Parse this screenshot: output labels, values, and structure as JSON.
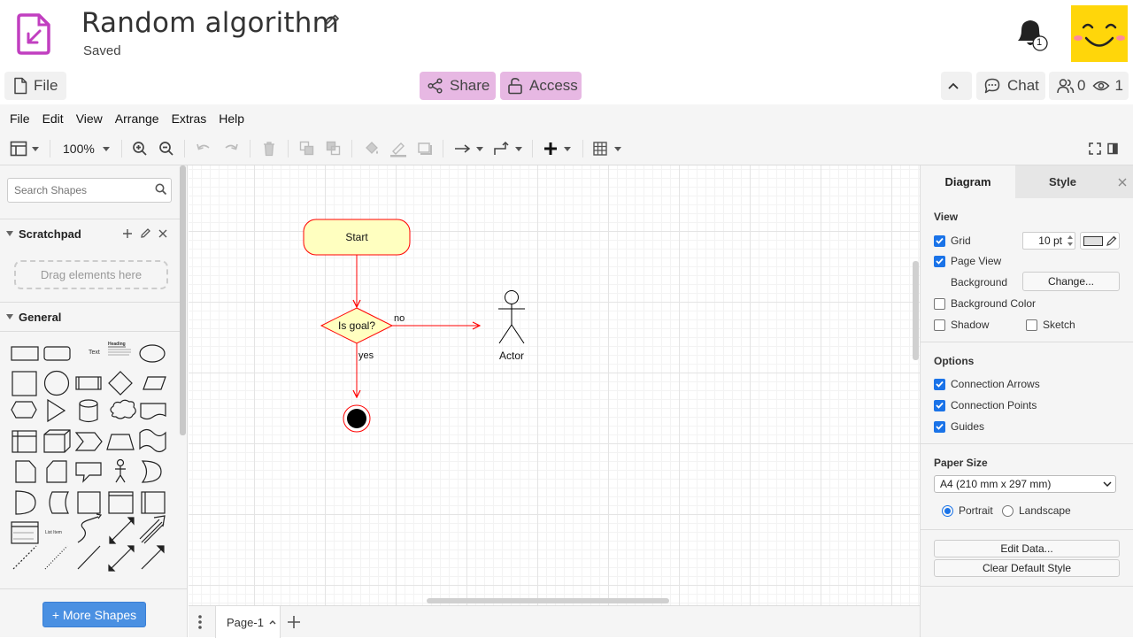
{
  "header": {
    "title": "Random algorithm",
    "status": "Saved",
    "notification_count": "1",
    "file_label": "File",
    "share_label": "Share",
    "access_label": "Access",
    "chat_label": "Chat",
    "users_count": "0",
    "viewers_count": "1"
  },
  "menu": [
    "File",
    "Edit",
    "View",
    "Arrange",
    "Extras",
    "Help"
  ],
  "toolbar": {
    "zoom": "100%"
  },
  "sidebar": {
    "search_placeholder": "Search Shapes",
    "scratchpad_label": "Scratchpad",
    "dropzone_text": "Drag elements here",
    "general_label": "General",
    "shape_text_label": "Text",
    "shape_heading_label": "Heading",
    "shape_list_item_label": "List Item",
    "more_shapes_label": "+ More Shapes"
  },
  "diagram": {
    "start_label": "Start",
    "decision_label": "Is goal?",
    "no_label": "no",
    "yes_label": "yes",
    "actor_label": "Actor",
    "stroke_color": "#ff0000",
    "fill_color": "#ffffc0"
  },
  "pagebar": {
    "page_name": "Page-1"
  },
  "panel": {
    "tab_diagram": "Diagram",
    "tab_style": "Style",
    "view_heading": "View",
    "grid_label": "Grid",
    "grid_size": "10 pt",
    "page_view_label": "Page View",
    "background_label": "Background",
    "change_button": "Change...",
    "background_color_label": "Background Color",
    "shadow_label": "Shadow",
    "sketch_label": "Sketch",
    "options_heading": "Options",
    "connection_arrows_label": "Connection Arrows",
    "connection_points_label": "Connection Points",
    "guides_label": "Guides",
    "paper_size_heading": "Paper Size",
    "paper_size_value": "A4 (210 mm x 297 mm)",
    "portrait_label": "Portrait",
    "landscape_label": "Landscape",
    "edit_data_button": "Edit Data...",
    "clear_style_button": "Clear Default Style"
  },
  "colors": {
    "accent_pink": "#e7b8e3",
    "logo_purple": "#c13fc0",
    "avatar_yellow": "#ffd60a",
    "checkbox_blue": "#1a73e8",
    "more_shapes_blue": "#4a90e2"
  }
}
